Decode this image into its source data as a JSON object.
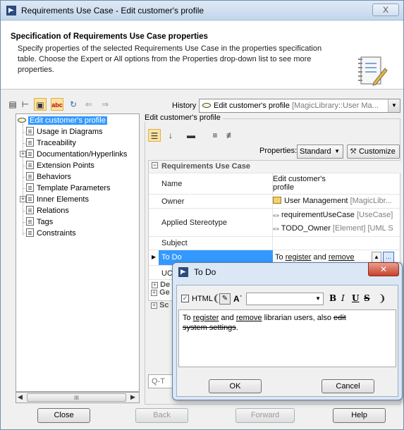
{
  "window": {
    "title": "Requirements Use Case - Edit customer's profile",
    "close_glyph": "X"
  },
  "header": {
    "title": "Specification of Requirements Use Case properties",
    "description": "Specify properties of the selected Requirements Use Case in the properties specification table. Choose the Expert or All options from the Properties drop-down list to see more properties."
  },
  "toolbar": {
    "history_label": "History :",
    "history_value": "Edit customer's profile",
    "history_muted": "[MagicLibrary::User Ma..."
  },
  "tree": {
    "root": "Edit customer's profile",
    "items": [
      {
        "label": "Usage in Diagrams",
        "expandable": false
      },
      {
        "label": "Traceability",
        "expandable": false
      },
      {
        "label": "Documentation/Hyperlinks",
        "expandable": true
      },
      {
        "label": "Extension Points",
        "expandable": false
      },
      {
        "label": "Behaviors",
        "expandable": false
      },
      {
        "label": "Template Parameters",
        "expandable": false
      },
      {
        "label": "Inner Elements",
        "expandable": true
      },
      {
        "label": "Relations",
        "expandable": false
      },
      {
        "label": "Tags",
        "expandable": false
      },
      {
        "label": "Constraints",
        "expandable": false
      }
    ],
    "scroll_mid": "III"
  },
  "panel": {
    "group_title": "Edit customer's profile",
    "properties_label": "Properties:",
    "properties_value": "Standard",
    "customize_label": "Customize",
    "section_title": "Requirements Use Case",
    "rows": {
      "name_label": "Name",
      "name_value_1": "Edit customer's",
      "name_value_2": "profile",
      "owner_label": "Owner",
      "owner_value": "User Management",
      "owner_muted": "[MagicLibr...",
      "stereo_label": "Applied Stereotype",
      "stereo_1": "requirementUseCase",
      "stereo_1_muted": "[UseCase]",
      "stereo_2": "TODO_Owner",
      "stereo_2_muted": "[Element] [UML S",
      "subject_label": "Subject",
      "todo_label": "To Do",
      "todo_value_pre": "To ",
      "todo_value_link1": "register",
      "todo_value_mid": " and ",
      "todo_value_link2": "remove",
      "uc_label": "UC",
      "de_label": "De",
      "ge_label": "Ge",
      "sc_label": "Sc"
    },
    "search_prefix": "Q-",
    "search_text": "T"
  },
  "dialog": {
    "title": "To Do",
    "html_label": "HTML",
    "bold": "B",
    "italic": "I",
    "underline": "U",
    "strike": "S",
    "text_pre": "To ",
    "link1": "register",
    "text_mid": " and ",
    "link2": "remove",
    "text_post": " librarian users, also ",
    "strike_1": "edit",
    "strike_2": "system settings",
    "strike_end": ".",
    "ok_label": "OK",
    "cancel_label": "Cancel"
  },
  "footer": {
    "close_label": "Close",
    "back_label": "Back",
    "forward_label": "Forward",
    "help_label": "Help"
  }
}
